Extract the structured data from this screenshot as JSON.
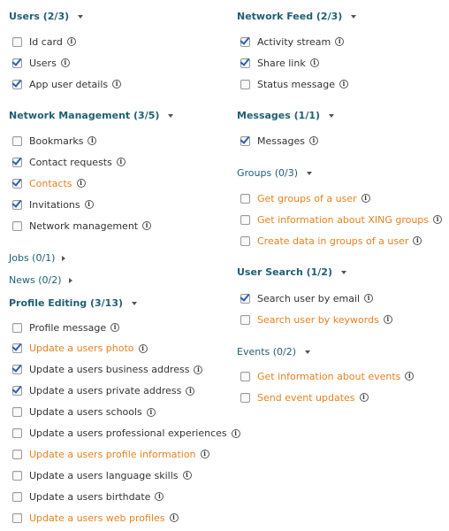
{
  "left": {
    "users": {
      "title": "Users (2/3)",
      "items": [
        {
          "label": "Id card",
          "checked": false,
          "orange": false
        },
        {
          "label": "Users",
          "checked": true,
          "orange": false
        },
        {
          "label": "App user details",
          "checked": true,
          "orange": false
        }
      ]
    },
    "network_management": {
      "title": "Network Management (3/5)",
      "items": [
        {
          "label": "Bookmarks",
          "checked": false,
          "orange": false
        },
        {
          "label": "Contact requests",
          "checked": true,
          "orange": false
        },
        {
          "label": "Contacts",
          "checked": true,
          "orange": true
        },
        {
          "label": "Invitations",
          "checked": true,
          "orange": false
        },
        {
          "label": "Network management",
          "checked": false,
          "orange": false
        }
      ]
    },
    "jobs": {
      "title": "Jobs (0/1)"
    },
    "news": {
      "title": "News (0/2)"
    },
    "profile_editing": {
      "title": "Profile Editing (3/13)",
      "items": [
        {
          "label": "Profile message",
          "checked": false,
          "orange": false
        },
        {
          "label": "Update a users photo",
          "checked": true,
          "orange": true
        },
        {
          "label": "Update a users business address",
          "checked": true,
          "orange": false
        },
        {
          "label": "Update a users private address",
          "checked": true,
          "orange": false
        },
        {
          "label": "Update a users schools",
          "checked": false,
          "orange": false
        },
        {
          "label": "Update a users professional experiences",
          "checked": false,
          "orange": false
        },
        {
          "label": "Update a users profile information",
          "checked": false,
          "orange": true
        },
        {
          "label": "Update a users language skills",
          "checked": false,
          "orange": false
        },
        {
          "label": "Update a users birthdate",
          "checked": false,
          "orange": false
        },
        {
          "label": "Update a users web profiles",
          "checked": false,
          "orange": true
        }
      ]
    }
  },
  "right": {
    "network_feed": {
      "title": "Network Feed (2/3)",
      "items": [
        {
          "label": "Activity stream",
          "checked": true,
          "orange": false
        },
        {
          "label": "Share link",
          "checked": true,
          "orange": false
        },
        {
          "label": "Status message",
          "checked": false,
          "orange": false
        }
      ]
    },
    "messages": {
      "title": "Messages (1/1)",
      "items": [
        {
          "label": "Messages",
          "checked": true,
          "orange": false
        }
      ]
    },
    "groups": {
      "title": "Groups (0/3)",
      "items": [
        {
          "label": "Get groups of a user",
          "checked": false,
          "orange": true
        },
        {
          "label": "Get information about XING groups",
          "checked": false,
          "orange": true
        },
        {
          "label": "Create data in groups of a user",
          "checked": false,
          "orange": true
        }
      ]
    },
    "user_search": {
      "title": "User Search (1/2)",
      "items": [
        {
          "label": "Search user by email",
          "checked": true,
          "orange": false
        },
        {
          "label": "Search user by keywords",
          "checked": false,
          "orange": true
        }
      ]
    },
    "events": {
      "title": "Events (0/2)",
      "items": [
        {
          "label": "Get information about events",
          "checked": false,
          "orange": true
        },
        {
          "label": "Send event updates",
          "checked": false,
          "orange": true
        }
      ]
    }
  },
  "icons": {
    "info": "i"
  },
  "colors": {
    "heading": "#1f5f73",
    "orange_link": "#e8811f",
    "check": "#2a5fb0"
  }
}
